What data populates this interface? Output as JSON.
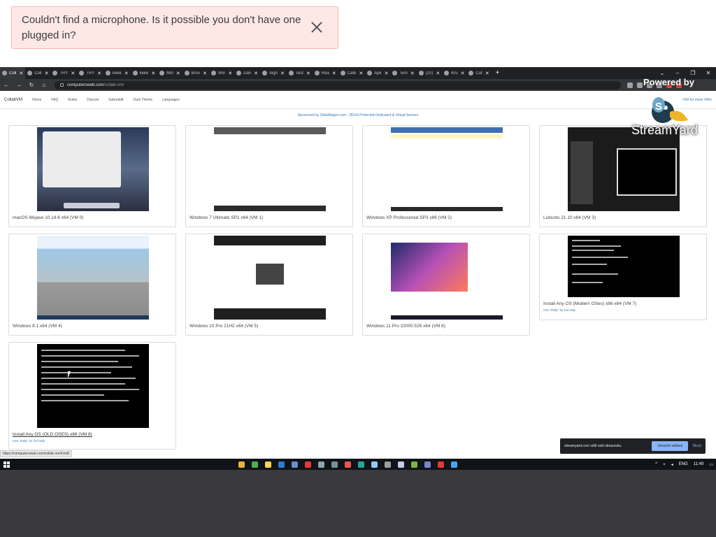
{
  "toast": {
    "message": "Couldn't find a microphone. Is it possible you don't have one plugged in?"
  },
  "browser": {
    "tabs": [
      {
        "label": "Coll",
        "active": true
      },
      {
        "label": "Coll"
      },
      {
        "label": "TRY"
      },
      {
        "label": "TRY"
      },
      {
        "label": "keke"
      },
      {
        "label": "keke"
      },
      {
        "label": "Mol"
      },
      {
        "label": "Brov"
      },
      {
        "label": "Win"
      },
      {
        "label": "Dan"
      },
      {
        "label": "Sign"
      },
      {
        "label": "Test"
      },
      {
        "label": "Rea"
      },
      {
        "label": "Cate"
      },
      {
        "label": "Apk"
      },
      {
        "label": "Tem"
      },
      {
        "label": "(20)"
      },
      {
        "label": "Kru"
      },
      {
        "label": "Cut"
      }
    ],
    "url_host": "computernewb.com",
    "url_path": "/collab-vm/",
    "status_url": "https://computernewb.com/collab-vm/#vm8"
  },
  "site": {
    "brand": "CollabVM",
    "nav": [
      "Home",
      "FAQ",
      "Rules",
      "Discord",
      "Subreddit",
      "Dark Theme",
      "Languages"
    ],
    "right_note": "rVM for more VMs!",
    "sponsor": "Sponsored by DataWagon.com - DDoS Protected Dedicated & Virtual Servers"
  },
  "vms": [
    {
      "title": "macOS Mojave 10.14.6 x64 (VM 0)",
      "sub": ""
    },
    {
      "title": "Windows 7 Ultimate SP1 x64 (VM 1)",
      "sub": ""
    },
    {
      "title": "Windows XP Professional SP3 x86 (VM 2)",
      "sub": ""
    },
    {
      "title": "Lubuntu 21.10 x64 (VM 3)",
      "sub": ""
    },
    {
      "title": "Windows 8.1 x64 (VM 4)",
      "sub": ""
    },
    {
      "title": "Windows 10 Pro 21H2 x64 (VM 5)",
      "sub": ""
    },
    {
      "title": "Windows 11 Pro 22000.526 x64 (VM 6)",
      "sub": ""
    },
    {
      "title": "Install Any OS (Modern OSes) x86-x64 (VM 7)",
      "sub": "Use \"!help\" for bot help"
    },
    {
      "title": "Install Any OS (OLD OSES) x86 (VM 8)",
      "sub": "Use \"!help\" for bot help"
    }
  ],
  "screenshare": {
    "text": "streamyard.com sdílí vaši obrazovku.",
    "stop": "Ukončit sdílení",
    "hide": "Skrýt"
  },
  "watermark": {
    "powered": "Powered by",
    "name": "StreamYard"
  },
  "system_tray": {
    "lang": "ENG",
    "time": "11:49"
  }
}
